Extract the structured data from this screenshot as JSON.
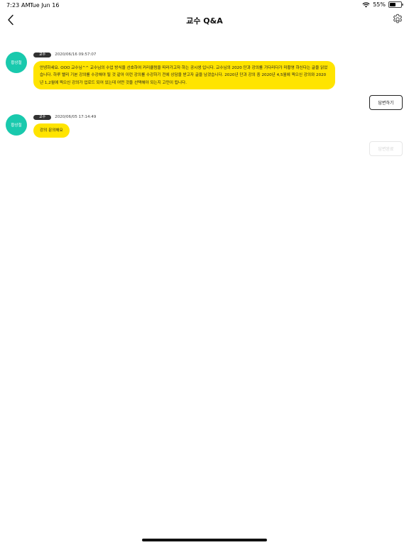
{
  "status_bar": {
    "time": "7:23 AM",
    "date": "Tue Jun 16",
    "battery": "55%",
    "battery_level": 0.55
  },
  "header": {
    "title": "교수 Q&A",
    "back_icon": "chevron-left-icon",
    "settings_icon": "gear-icon"
  },
  "messages": [
    {
      "author": "황상철",
      "role": "교수",
      "timestamp": "2020/06/16 09:57:07",
      "text": "안녕하세요. OOO 교수님^^ 교수님의 수업 방식을 선호하여 커리큘럼을 따라가고자 하는 공시생 입니다. 교수님의 2020 단과 강의를 기다리다가 미황영 하신다는 글을 읽었습니다. 하루 빨리 기본 강의를 수강해야 될 것 같아 이런 강의를 수강하기 전에 상담을 받고자 글을 남겼습니다. 2020년 단과 강의 중 2020년 4,5월에 찍으신 강의와 2020년 1,2월에 찍으신 강의가 업로드 되어 있는데 어떤 것을 선택해야 되는지 고민이 됩니다.",
      "reply_label": "답변하기",
      "reply_enabled": true
    },
    {
      "author": "황상철",
      "role": "교수",
      "timestamp": "2020/06/05 17:14:49",
      "text": "강의 문의해요",
      "reply_label": "답변완료",
      "reply_enabled": false
    }
  ],
  "colors": {
    "bubble": "#ffe400",
    "avatar": "#19c9ad",
    "badge": "#333333"
  }
}
